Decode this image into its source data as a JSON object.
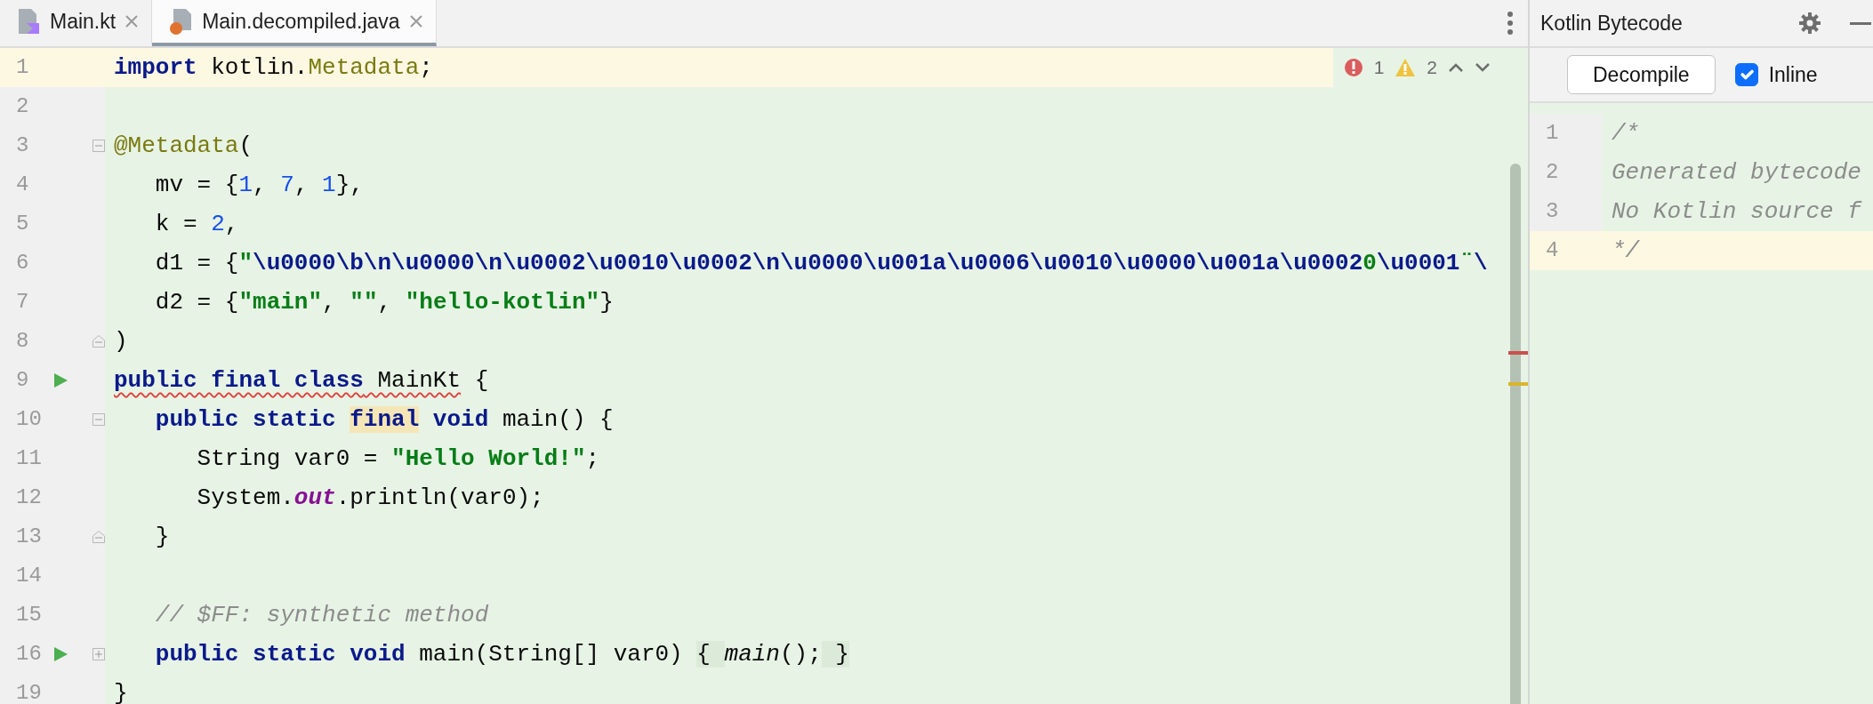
{
  "tabs": [
    {
      "label": "Main.kt",
      "kind": "kotlin",
      "selected": false
    },
    {
      "label": "Main.decompiled.java",
      "kind": "java",
      "selected": true
    }
  ],
  "editor": {
    "inspections": {
      "errors": "1",
      "warnings": "2"
    },
    "lines": [
      {
        "number": "1",
        "current": true,
        "tokens": [
          {
            "kind": "kw",
            "text": "import"
          },
          {
            "kind": "plain",
            "text": " kotlin."
          },
          {
            "kind": "type",
            "text": "Metadata"
          },
          {
            "kind": "plain",
            "text": ";"
          }
        ]
      },
      {
        "number": "2",
        "current": false
      },
      {
        "number": "3",
        "current": false,
        "fold": {
          "kind": "start"
        },
        "tokens": [
          {
            "kind": "annotation",
            "text": "@Metadata"
          },
          {
            "kind": "plain",
            "text": "("
          }
        ]
      },
      {
        "number": "4",
        "current": false,
        "tokens": [
          {
            "kind": "plain",
            "text": "   mv = {"
          },
          {
            "kind": "num",
            "text": "1"
          },
          {
            "kind": "plain",
            "text": ", "
          },
          {
            "kind": "num",
            "text": "7"
          },
          {
            "kind": "plain",
            "text": ", "
          },
          {
            "kind": "num",
            "text": "1"
          },
          {
            "kind": "plain",
            "text": "},"
          }
        ]
      },
      {
        "number": "5",
        "current": false,
        "tokens": [
          {
            "kind": "plain",
            "text": "   k = "
          },
          {
            "kind": "num",
            "text": "2"
          },
          {
            "kind": "plain",
            "text": ","
          }
        ]
      },
      {
        "number": "6",
        "current": false,
        "tokens": [
          {
            "kind": "plain",
            "text": "   d1 = {"
          },
          {
            "kind": "str",
            "text": "\""
          },
          {
            "kind": "esc",
            "text": "\\u0000\\b\\n\\u0000\\n\\u0002\\u0010\\u0002\\n\\u0000\\u001a\\u0006\\u0010\\u0000\\u001a\\u0002"
          },
          {
            "kind": "str",
            "text": "0"
          },
          {
            "kind": "esc",
            "text": "\\u0001"
          },
          {
            "kind": "str",
            "text": "¨"
          },
          {
            "kind": "esc",
            "text": "\\"
          }
        ]
      },
      {
        "number": "7",
        "current": false,
        "tokens": [
          {
            "kind": "plain",
            "text": "   d2 = {"
          },
          {
            "kind": "str",
            "text": "\"main\""
          },
          {
            "kind": "plain",
            "text": ", "
          },
          {
            "kind": "str",
            "text": "\"\""
          },
          {
            "kind": "plain",
            "text": ", "
          },
          {
            "kind": "str",
            "text": "\"hello-kotlin\""
          },
          {
            "kind": "plain",
            "text": "}"
          }
        ]
      },
      {
        "number": "8",
        "current": false,
        "fold": {
          "kind": "end"
        },
        "tokens": [
          {
            "kind": "plain",
            "text": ")"
          }
        ]
      },
      {
        "number": "9",
        "current": false,
        "run": true,
        "tokens": [
          {
            "kind": "kw",
            "text": "public final class",
            "error": true
          },
          {
            "kind": "plain",
            "text": " MainKt",
            "error": true
          },
          {
            "kind": "plain",
            "text": " {"
          }
        ]
      },
      {
        "number": "10",
        "current": false,
        "fold": {
          "kind": "start"
        },
        "tokens": [
          {
            "kind": "kw",
            "text": "   public static "
          },
          {
            "kind": "kw",
            "text": "final",
            "warning": true
          },
          {
            "kind": "kw",
            "text": " void"
          },
          {
            "kind": "plain",
            "text": " main() {"
          }
        ]
      },
      {
        "number": "11",
        "current": false,
        "tokens": [
          {
            "kind": "plain",
            "text": "      String var0 = "
          },
          {
            "kind": "str",
            "text": "\"Hello World!\""
          },
          {
            "kind": "plain",
            "text": ";"
          }
        ]
      },
      {
        "number": "12",
        "current": false,
        "tokens": [
          {
            "kind": "plain",
            "text": "      System."
          },
          {
            "kind": "field",
            "text": "out"
          },
          {
            "kind": "plain",
            "text": ".println(var0);"
          }
        ]
      },
      {
        "number": "13",
        "current": false,
        "fold": {
          "kind": "end"
        },
        "tokens": [
          {
            "kind": "plain",
            "text": "   }"
          }
        ]
      },
      {
        "number": "14",
        "current": false
      },
      {
        "number": "15",
        "current": false,
        "tokens": [
          {
            "kind": "comment",
            "text": "   // $FF: synthetic method"
          }
        ]
      },
      {
        "number": "16",
        "current": false,
        "run": true,
        "fold": {
          "kind": "collapsed"
        },
        "tokens": [
          {
            "kind": "kw",
            "text": "   public static void"
          },
          {
            "kind": "plain",
            "text": " main(String[] var0) "
          },
          {
            "kind": "folded",
            "text": "{ "
          },
          {
            "kind": "call",
            "text": "main"
          },
          {
            "kind": "plain",
            "text": "();"
          },
          {
            "kind": "folded",
            "text": " }"
          }
        ]
      },
      {
        "number": "19",
        "current": false,
        "tokens": [
          {
            "kind": "plain",
            "text": "}"
          }
        ]
      }
    ]
  },
  "bytecode_panel": {
    "title": "Kotlin Bytecode",
    "decompile_button": "Decompile",
    "inline": {
      "label": "Inline",
      "checked": true
    },
    "lines": [
      {
        "number": "1",
        "current": false,
        "text": "/*"
      },
      {
        "number": "2",
        "current": false,
        "text": "Generated bytecode"
      },
      {
        "number": "3",
        "current": false,
        "text": "No Kotlin source f"
      },
      {
        "number": "4",
        "current": true,
        "text": "*/"
      }
    ]
  }
}
